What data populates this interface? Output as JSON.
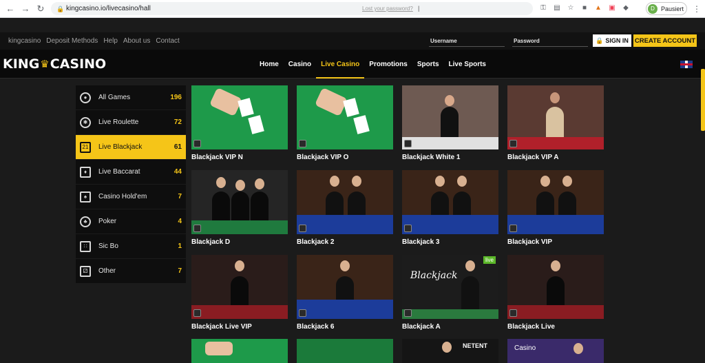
{
  "browser": {
    "url": "kingcasino.io/livecasino/hall",
    "profile_initial": "D",
    "profile_label": "Pausiert"
  },
  "topbar": {
    "links": [
      "kingcasino",
      "Deposit Methods",
      "Help",
      "About us",
      "Contact"
    ],
    "lost_password": "Lost your password?",
    "separator": "|",
    "username_placeholder": "Username",
    "password_placeholder": "Password",
    "signin_label": "SIGN IN",
    "create_account_label": "CREATE ACCOUNT"
  },
  "logo": {
    "left": "KING",
    "right": "CASINO"
  },
  "nav": {
    "items": [
      "Home",
      "Casino",
      "Live Casino",
      "Promotions",
      "Sports",
      "Live Sports"
    ],
    "active": "Live Casino"
  },
  "sidebar": {
    "items": [
      {
        "label": "All Games",
        "count": "196"
      },
      {
        "label": "Live Roulette",
        "count": "72"
      },
      {
        "label": "Live Blackjack",
        "count": "61"
      },
      {
        "label": "Live Baccarat",
        "count": "44"
      },
      {
        "label": "Casino Hold'em",
        "count": "7"
      },
      {
        "label": "Poker",
        "count": "4"
      },
      {
        "label": "Sic Bo",
        "count": "1"
      },
      {
        "label": "Other",
        "count": "7"
      }
    ]
  },
  "games": [
    {
      "title": "Blackjack VIP N"
    },
    {
      "title": "Blackjack VIP O"
    },
    {
      "title": "Blackjack White 1"
    },
    {
      "title": "Blackjack VIP A"
    },
    {
      "title": "Blackjack D"
    },
    {
      "title": "Blackjack 2"
    },
    {
      "title": "Blackjack 3"
    },
    {
      "title": "Blackjack VIP"
    },
    {
      "title": "Blackjack Live VIP"
    },
    {
      "title": "Blackjack 6"
    },
    {
      "title": "Blackjack A"
    },
    {
      "title": "Blackjack Live"
    }
  ],
  "thumb_text": {
    "blackjack_a": "Blackjack",
    "live_tag": "live",
    "netent": "NETENT",
    "casino": "Casino"
  },
  "colors": {
    "accent": "#f5c518",
    "background": "#1b1b1b"
  }
}
